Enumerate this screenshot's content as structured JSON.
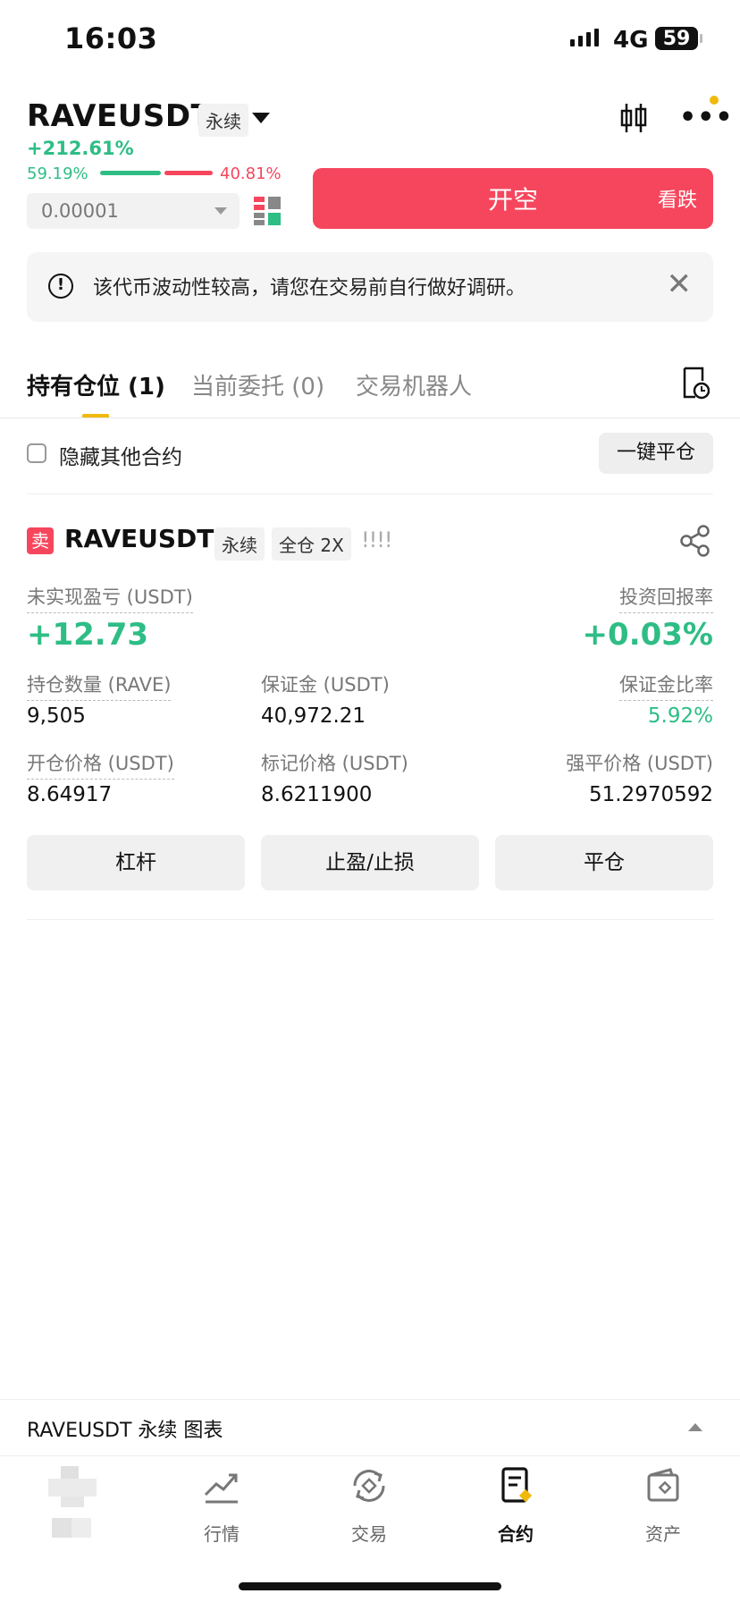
{
  "status_bar": {
    "time": "16:03",
    "network": "4G",
    "battery": "59"
  },
  "header": {
    "pair": "RAVEUSDT",
    "contract_type": "永续",
    "change": "+212.61%"
  },
  "order_panel": {
    "long_ratio": "59.19%",
    "short_ratio": "40.81%",
    "depth_precision": "0.00001",
    "short_button": {
      "label": "开空",
      "sub_label": "看跌"
    }
  },
  "notice": {
    "text": "该代币波动性较高，请您在交易前自行做好调研。"
  },
  "tabs": [
    {
      "label": "持有仓位 (1)"
    },
    {
      "label": "当前委托 (0)"
    },
    {
      "label": "交易机器人"
    }
  ],
  "filter": {
    "hide_others_label": "隐藏其他合约",
    "close_all_label": "一键平仓"
  },
  "position": {
    "side": "卖",
    "symbol": "RAVEUSDT",
    "tag_type": "永续",
    "tag_margin": "全仓 2X",
    "risk": "!!!!",
    "unrealized_pnl_label": "未实现盈亏 (USDT)",
    "unrealized_pnl": "+12.73",
    "roi_label": "投资回报率",
    "roi": "+0.03%",
    "size_label": "持仓数量 (RAVE)",
    "size": "9,505",
    "margin_label": "保证金 (USDT)",
    "margin": "40,972.21",
    "margin_ratio_label": "保证金比率",
    "margin_ratio": "5.92%",
    "entry_price_label": "开仓价格 (USDT)",
    "entry_price": "8.64917",
    "mark_price_label": "标记价格 (USDT)",
    "mark_price": "8.6211900",
    "liq_price_label": "强平价格 (USDT)",
    "liq_price": "51.2970592",
    "actions": [
      "杠杆",
      "止盈/止损",
      "平仓"
    ]
  },
  "chart_bar": {
    "label": "RAVEUSDT 永续 图表"
  },
  "bottom_nav": [
    {
      "label": "行情",
      "icon": "market-chart-icon"
    },
    {
      "label": "交易",
      "icon": "trade-swap-icon"
    },
    {
      "label": "合约",
      "icon": "contract-doc-icon"
    },
    {
      "label": "资产",
      "icon": "wallet-icon"
    }
  ],
  "colors": {
    "green": "#2ebd85",
    "red": "#f6465d",
    "accent": "#f0b90b"
  }
}
